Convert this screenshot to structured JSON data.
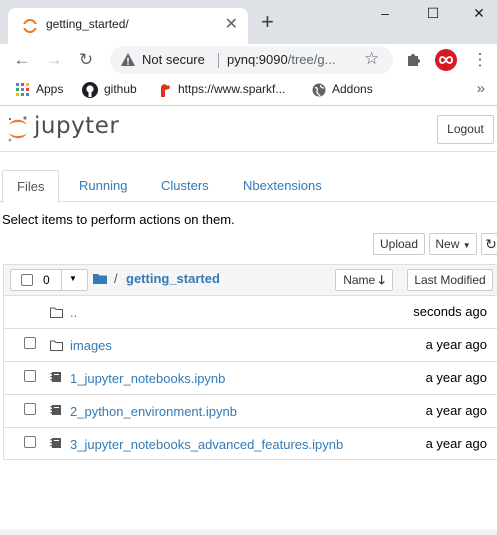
{
  "browser": {
    "tab_title": "getting_started/",
    "not_secure": "Not secure",
    "url_host": "pynq:9090",
    "url_path": "/tree/g...",
    "bookmarks": [
      {
        "label": "Apps",
        "icon": "apps-grid-icon"
      },
      {
        "label": "github",
        "icon": "github-icon"
      },
      {
        "label": "https://www.sparkf...",
        "icon": "sparkfun-icon"
      },
      {
        "label": "Addons",
        "icon": "globe-icon"
      }
    ]
  },
  "jupyter": {
    "logo_text": "jupyter",
    "logout_label": "Logout",
    "tabs": [
      {
        "label": "Files",
        "active": true
      },
      {
        "label": "Running",
        "active": false
      },
      {
        "label": "Clusters",
        "active": false
      },
      {
        "label": "Nbextensions",
        "active": false
      }
    ],
    "hint": "Select items to perform actions on them.",
    "upload_label": "Upload",
    "new_label": "New",
    "selected_count": "0",
    "breadcrumb_sep": "/",
    "current_dir": "getting_started",
    "sort_name_label": "Name",
    "sort_modified_label": "Last Modified",
    "items": [
      {
        "name": "..",
        "type": "folder",
        "modified": "seconds ago"
      },
      {
        "name": "images",
        "type": "folder",
        "modified": "a year ago"
      },
      {
        "name": "1_jupyter_notebooks.ipynb",
        "type": "notebook",
        "modified": "a year ago"
      },
      {
        "name": "2_python_environment.ipynb",
        "type": "notebook",
        "modified": "a year ago"
      },
      {
        "name": "3_jupyter_notebooks_advanced_features.ipynb",
        "type": "notebook",
        "modified": "a year ago"
      }
    ]
  },
  "colors": {
    "link": "#337ab7",
    "jupyter_orange": "#f37726",
    "chrome_frame": "#dee1e6"
  }
}
